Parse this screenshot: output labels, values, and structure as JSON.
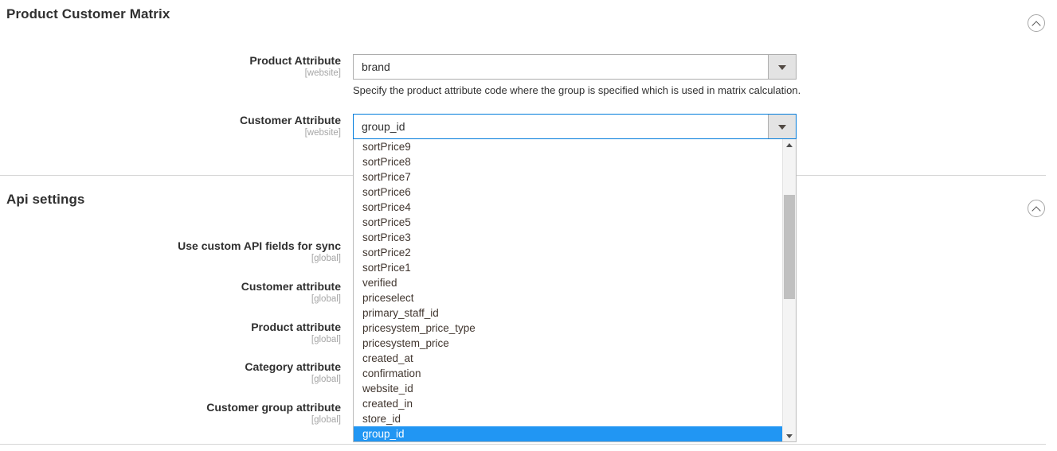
{
  "sections": [
    {
      "title": "Product Customer Matrix",
      "collapse_icon": "chevron-up-circle-icon"
    },
    {
      "title": "Api settings",
      "collapse_icon": "chevron-up-circle-icon"
    }
  ],
  "matrix_fields": [
    {
      "label": "Product Attribute",
      "scope": "[website]",
      "value": "brand",
      "hint": "Specify the product attribute code where the group is specified which is used in matrix calculation."
    },
    {
      "label": "Customer Attribute",
      "scope": "[website]",
      "value": "group_id",
      "hint": ""
    }
  ],
  "api_fields": [
    {
      "label": "Use custom API fields for sync",
      "scope": "[global]"
    },
    {
      "label": "Customer attribute",
      "scope": "[global]"
    },
    {
      "label": "Product attribute",
      "scope": "[global]"
    },
    {
      "label": "Category attribute",
      "scope": "[global]"
    },
    {
      "label": "Customer group attribute",
      "scope": "[global]"
    }
  ],
  "dropdown": {
    "selected": "group_id",
    "options": [
      "sortPrice9",
      "sortPrice8",
      "sortPrice7",
      "sortPrice6",
      "sortPrice4",
      "sortPrice5",
      "sortPrice3",
      "sortPrice2",
      "sortPrice1",
      "verified",
      "priceselect",
      "primary_staff_id",
      "pricesystem_price_type",
      "pricesystem_price",
      "created_at",
      "confirmation",
      "website_id",
      "created_in",
      "store_id",
      "group_id"
    ],
    "scroll_up_icon": "triangle-up-icon",
    "scroll_down_icon": "triangle-down-icon"
  },
  "colors": {
    "highlight": "#2196f3",
    "focus_border": "#007bdb",
    "text": "#303030",
    "scope_text": "#a6a6a6",
    "divider": "#d6d6d6"
  }
}
